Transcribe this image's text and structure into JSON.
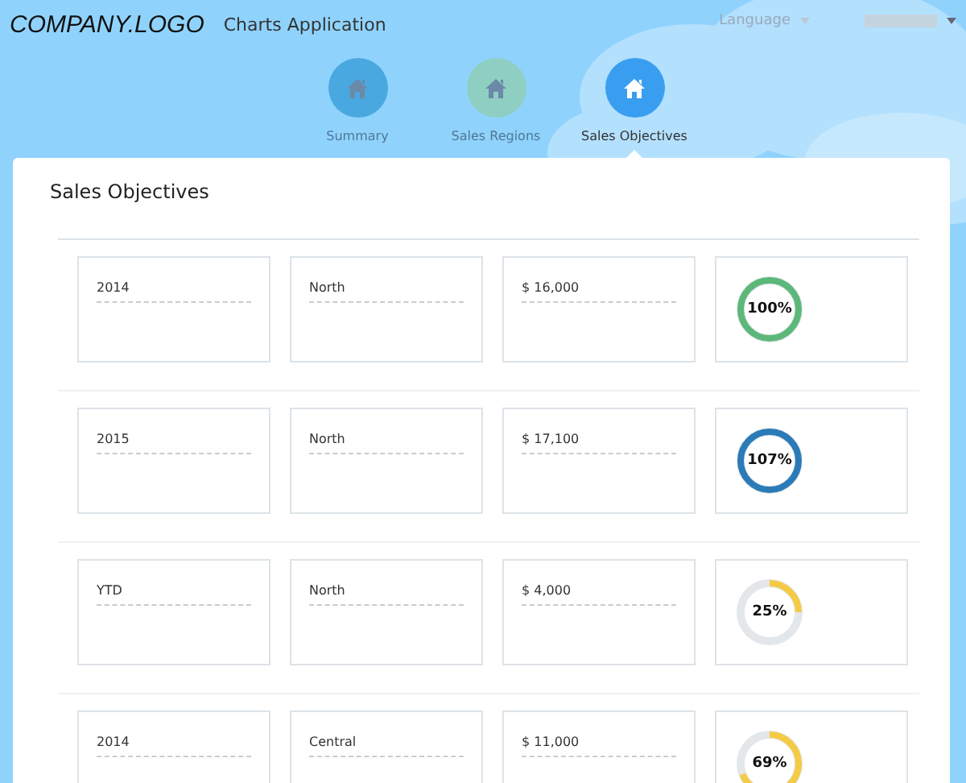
{
  "header": {
    "logo": "COMPANY.LOGO",
    "app_title": "Charts Application",
    "language": "Language"
  },
  "nav": [
    {
      "label": "Summary",
      "color": "#4aa8e0",
      "selected": false
    },
    {
      "label": "Sales Regions",
      "color": "#8ecfc2",
      "selected": false
    },
    {
      "label": "Sales Objectives",
      "color": "#3a9ef0",
      "selected": true
    }
  ],
  "panel": {
    "title": "Sales Objectives",
    "rows": [
      {
        "period": "2014",
        "region": "North",
        "amount": "$ 16,000",
        "progress": {
          "text": "100%",
          "color": "#5cb87a"
        }
      },
      {
        "period": "2015",
        "region": "North",
        "amount": "$ 17,100",
        "progress": {
          "text": "107%",
          "color": "#2b7bb8"
        }
      },
      {
        "period": "YTD",
        "region": "North",
        "amount": "$ 4,000",
        "progress": {
          "text": "25%",
          "color": "#f5ca45"
        }
      },
      {
        "period": "2014",
        "region": "Central",
        "amount": "$ 11,000",
        "progress": {
          "text": "69%",
          "color": "#f5ca45"
        }
      }
    ]
  }
}
